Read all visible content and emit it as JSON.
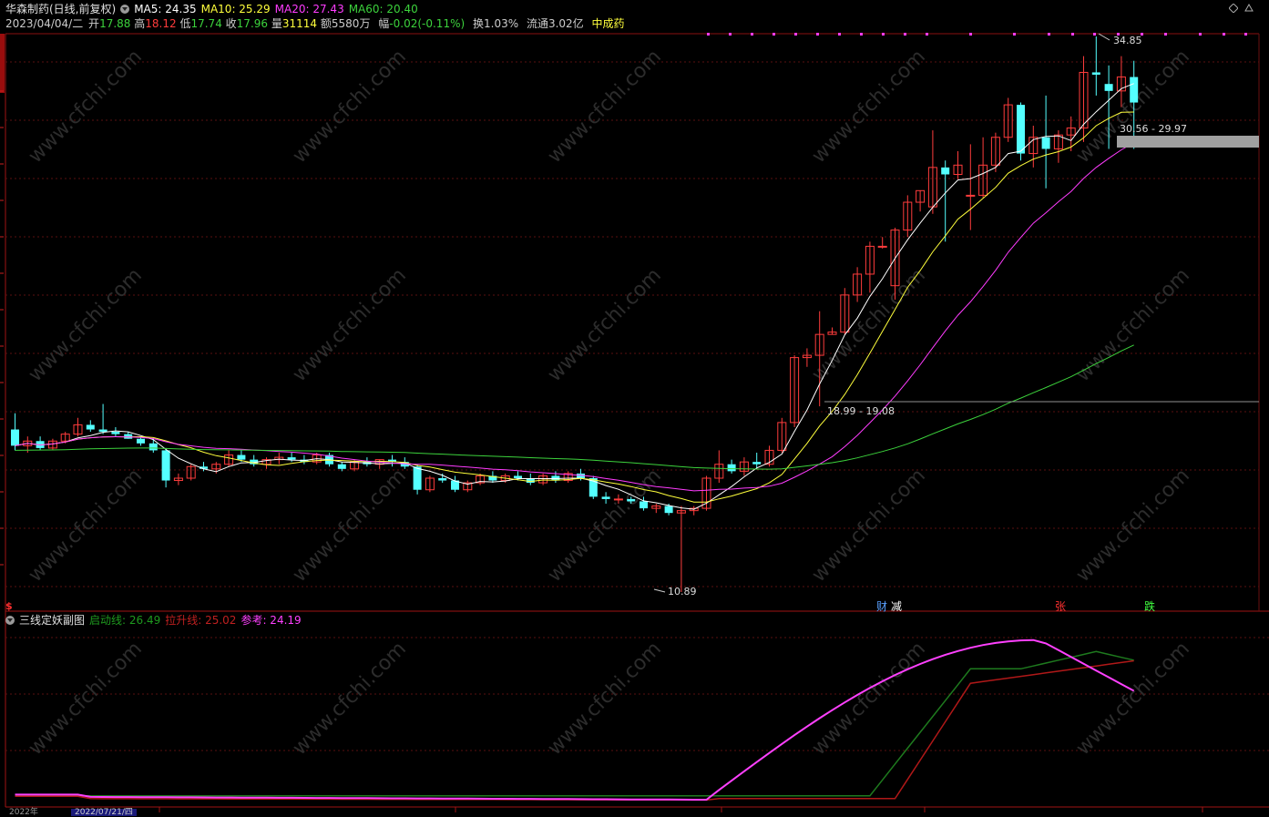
{
  "header": {
    "stock_title": "华森制药(日线,前复权)",
    "ma5": "MA5: 24.35",
    "ma10": "MA10: 25.29",
    "ma20": "MA20: 27.43",
    "ma60": "MA60: 20.40",
    "date": "2023/04/04/二",
    "open_label": "开",
    "open": "17.88",
    "high_label": "高",
    "high": "18.12",
    "low_label": "低",
    "low": "17.74",
    "close_label": "收",
    "close": "17.96",
    "volume_label": "量",
    "volume": "31114",
    "amount_label": "额",
    "amount": "5580万",
    "change_label": "幅",
    "change": "-0.02(-0.11%)",
    "turnover": "换1.03%",
    "float_cap": "流通3.02亿",
    "sector": "中成药"
  },
  "price_annotations": {
    "high_marker": "34.85",
    "low_marker": "10.89",
    "range_upper": "30.56 - 29.97",
    "range_lower": "18.99 - 19.08",
    "dollar_marker": "$"
  },
  "event_tags": [
    {
      "text": "财",
      "color": "#5aa0ff"
    },
    {
      "text": "减",
      "color": "#ffffff"
    },
    {
      "text": "张",
      "color": "#ff3030"
    },
    {
      "text": "跌",
      "color": "#40ff40"
    }
  ],
  "sub_chart": {
    "title": "三线定妖副图",
    "line1_label": "启动线: 26.49",
    "line2_label": "拉升线: 25.02",
    "line3_label": "参考: 24.19"
  },
  "bottom_axis": {
    "left_label": "2022年",
    "selected_date": "2022/07/21/四"
  },
  "watermark": "www.cfchi.com",
  "colors": {
    "up": "#ff3c3c",
    "down": "#54ffff",
    "ma5": "#ffffff",
    "ma10": "#ffff3c",
    "ma20": "#ff3cff",
    "ma60": "#3cd23c",
    "start_line": "#1e7a1e",
    "rise_line": "#b01818",
    "ref_line": "#ff40ff"
  },
  "chart_data": {
    "type": "candlestick",
    "price_high": 34.85,
    "price_low": 10.89,
    "candles": [
      [
        17.9,
        18.6,
        17.0,
        17.2
      ],
      [
        17.2,
        17.6,
        16.9,
        17.4
      ],
      [
        17.4,
        17.6,
        17.0,
        17.1
      ],
      [
        17.1,
        17.5,
        17.0,
        17.4
      ],
      [
        17.4,
        17.8,
        17.3,
        17.7
      ],
      [
        17.7,
        18.4,
        17.6,
        18.1
      ],
      [
        18.1,
        18.3,
        17.8,
        17.9
      ],
      [
        17.9,
        19.0,
        17.7,
        17.8
      ],
      [
        17.8,
        18.0,
        17.6,
        17.7
      ],
      [
        17.7,
        17.8,
        17.5,
        17.5
      ],
      [
        17.5,
        17.6,
        17.2,
        17.3
      ],
      [
        17.3,
        17.5,
        16.9,
        17.0
      ],
      [
        17.0,
        17.1,
        15.4,
        15.7
      ],
      [
        15.7,
        16.0,
        15.5,
        15.8
      ],
      [
        15.8,
        16.4,
        15.7,
        16.3
      ],
      [
        16.3,
        16.5,
        16.1,
        16.2
      ],
      [
        16.2,
        16.5,
        16.0,
        16.4
      ],
      [
        16.4,
        17.0,
        16.3,
        16.8
      ],
      [
        16.8,
        17.0,
        16.5,
        16.6
      ],
      [
        16.6,
        16.8,
        16.3,
        16.4
      ],
      [
        16.4,
        16.7,
        16.2,
        16.6
      ],
      [
        16.6,
        16.9,
        16.4,
        16.7
      ],
      [
        16.7,
        16.9,
        16.5,
        16.6
      ],
      [
        16.6,
        16.8,
        16.4,
        16.5
      ],
      [
        16.5,
        16.9,
        16.4,
        16.8
      ],
      [
        16.8,
        16.9,
        16.3,
        16.4
      ],
      [
        16.4,
        16.5,
        16.1,
        16.2
      ],
      [
        16.2,
        16.6,
        16.1,
        16.5
      ],
      [
        16.5,
        16.7,
        16.3,
        16.4
      ],
      [
        16.4,
        16.6,
        16.2,
        16.6
      ],
      [
        16.6,
        16.8,
        16.3,
        16.5
      ],
      [
        16.5,
        16.7,
        16.2,
        16.3
      ],
      [
        16.3,
        16.4,
        15.1,
        15.3
      ],
      [
        15.3,
        15.9,
        15.2,
        15.8
      ],
      [
        15.8,
        16.0,
        15.6,
        15.7
      ],
      [
        15.7,
        15.9,
        15.2,
        15.3
      ],
      [
        15.3,
        15.7,
        15.2,
        15.6
      ],
      [
        15.6,
        16.0,
        15.5,
        15.9
      ],
      [
        15.9,
        16.1,
        15.6,
        15.7
      ],
      [
        15.7,
        16.0,
        15.6,
        15.9
      ],
      [
        15.9,
        16.1,
        15.7,
        15.8
      ],
      [
        15.8,
        16.0,
        15.5,
        15.6
      ],
      [
        15.6,
        16.0,
        15.5,
        15.9
      ],
      [
        15.9,
        16.1,
        15.6,
        15.7
      ],
      [
        15.7,
        16.1,
        15.6,
        16.0
      ],
      [
        16.0,
        16.2,
        15.7,
        15.8
      ],
      [
        15.8,
        15.9,
        14.9,
        15.0
      ],
      [
        15.0,
        15.2,
        14.7,
        14.9
      ],
      [
        14.9,
        15.1,
        14.7,
        14.9
      ],
      [
        14.9,
        15.0,
        14.7,
        14.8
      ],
      [
        14.8,
        15.0,
        14.4,
        14.5
      ],
      [
        14.5,
        14.7,
        14.3,
        14.6
      ],
      [
        14.6,
        14.7,
        14.2,
        14.3
      ],
      [
        14.3,
        14.6,
        10.89,
        14.4
      ],
      [
        14.4,
        14.6,
        14.2,
        14.5
      ],
      [
        14.5,
        15.9,
        14.4,
        15.8
      ],
      [
        15.8,
        17.0,
        15.6,
        16.4
      ],
      [
        16.4,
        16.6,
        16.0,
        16.1
      ],
      [
        16.1,
        16.7,
        15.9,
        16.5
      ],
      [
        16.5,
        16.9,
        16.2,
        16.4
      ],
      [
        16.4,
        17.2,
        16.3,
        17.0
      ],
      [
        17.0,
        18.4,
        16.9,
        18.2
      ],
      [
        18.2,
        21.1,
        18.0,
        21.0
      ],
      [
        21.0,
        21.4,
        20.6,
        21.1
      ],
      [
        21.1,
        23.0,
        18.9,
        22.0
      ],
      [
        22.0,
        22.3,
        22.0,
        22.1
      ],
      [
        22.1,
        24.0,
        22.0,
        23.7
      ],
      [
        23.7,
        24.9,
        23.4,
        24.6
      ],
      [
        24.6,
        26.0,
        23.8,
        25.8
      ],
      [
        25.8,
        26.2,
        25.7,
        25.8
      ],
      [
        24.1,
        26.6,
        23.5,
        26.5
      ],
      [
        26.5,
        28.0,
        26.2,
        27.7
      ],
      [
        27.7,
        28.2,
        27.3,
        28.2
      ],
      [
        27.5,
        30.8,
        27.2,
        29.2
      ],
      [
        29.2,
        29.5,
        26.0,
        28.9
      ],
      [
        28.9,
        29.9,
        28.7,
        29.3
      ],
      [
        28.0,
        30.2,
        26.5,
        28.0
      ],
      [
        28.0,
        30.5,
        27.9,
        29.3
      ],
      [
        29.3,
        30.7,
        29.0,
        30.5
      ],
      [
        30.5,
        32.2,
        30.3,
        31.9
      ],
      [
        31.9,
        32.0,
        29.5,
        29.8
      ],
      [
        29.8,
        31.0,
        29.2,
        30.5
      ],
      [
        30.5,
        32.3,
        28.3,
        30.0
      ],
      [
        30.0,
        30.8,
        29.4,
        30.6
      ],
      [
        30.6,
        31.4,
        29.9,
        30.9
      ],
      [
        30.9,
        34.0,
        30.3,
        33.3
      ],
      [
        33.3,
        34.85,
        32.3,
        33.2
      ],
      [
        32.8,
        33.6,
        30.0,
        32.5
      ],
      [
        32.5,
        34.0,
        31.8,
        33.1
      ],
      [
        33.1,
        33.8,
        30.0,
        32.0
      ]
    ],
    "sub_series": [
      {
        "name": "启动线",
        "value": 26.49
      },
      {
        "name": "拉升线",
        "value": 25.02
      },
      {
        "name": "参考",
        "value": 24.19
      }
    ]
  }
}
